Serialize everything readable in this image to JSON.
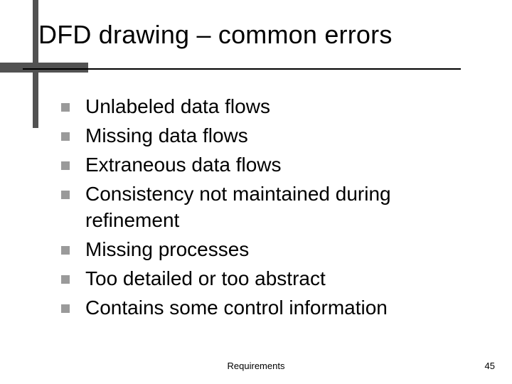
{
  "title": "DFD drawing – common errors",
  "bullets": [
    "Unlabeled data flows",
    "Missing data flows",
    "Extraneous data flows",
    "Consistency not maintained during refinement",
    "Missing processes",
    "Too detailed or too abstract",
    "Contains some control information"
  ],
  "footer": {
    "center": "Requirements",
    "page": "45"
  }
}
